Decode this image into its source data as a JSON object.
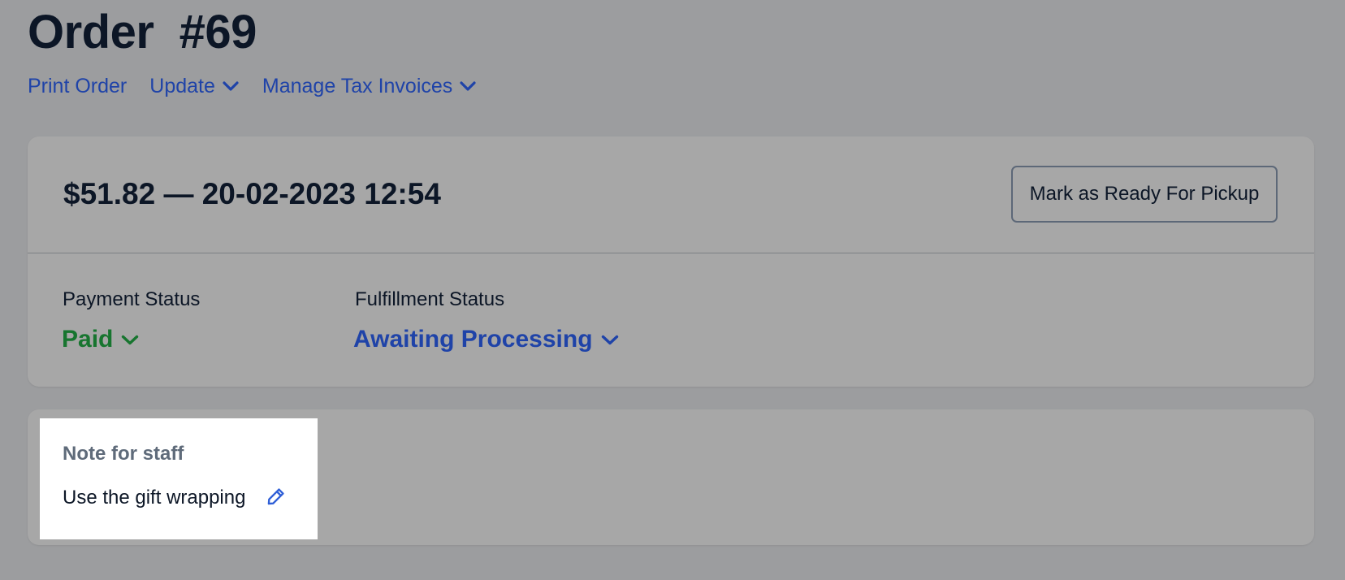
{
  "header": {
    "title": "Order  #69",
    "actions": [
      {
        "label": "Print Order",
        "has_dropdown": false
      },
      {
        "label": "Update",
        "has_dropdown": true
      },
      {
        "label": "Manage Tax Invoices",
        "has_dropdown": true
      }
    ]
  },
  "order_card": {
    "summary": "$51.82 — 20-02-2023 12:54",
    "ready_button_label": "Mark as Ready For Pickup",
    "payment_status": {
      "label": "Payment Status",
      "value": "Paid",
      "color": "#17752f"
    },
    "fulfillment_status": {
      "label": "Fulfillment Status",
      "value": "Awaiting Processing",
      "color": "#1f43a8"
    }
  },
  "note_card": {
    "heading": "Note for staff",
    "text": "Use the gift wrapping",
    "edit_icon": "pencil-icon"
  },
  "colors": {
    "link": "#1f43a8",
    "paid": "#17752f",
    "text": "#0c1626",
    "muted": "#5f6b7a",
    "edit_icon": "#2f5fd7"
  }
}
